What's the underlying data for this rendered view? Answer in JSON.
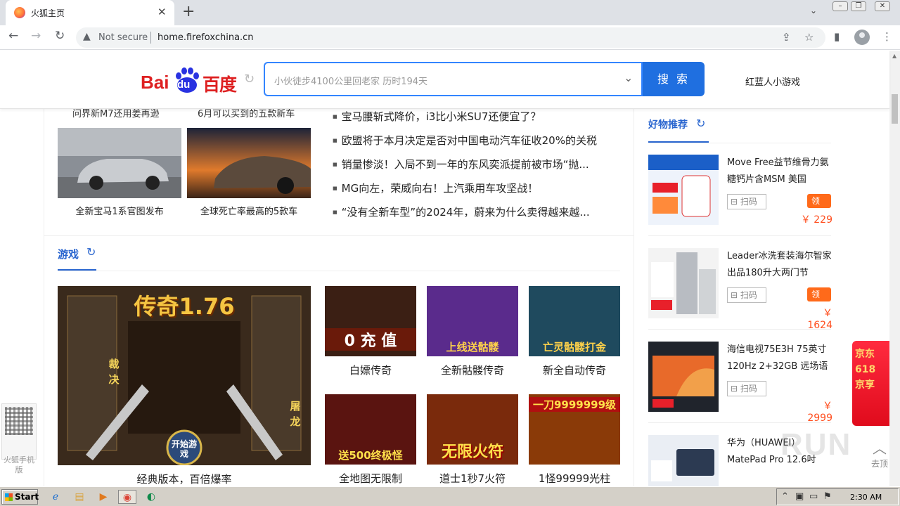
{
  "browser": {
    "tab_title": "火狐主页",
    "address_warning": "Not secure",
    "url": "home.firefoxchina.cn"
  },
  "header": {
    "logo_text_en": "Bai",
    "logo_du": "du",
    "logo_text_cn": "百度",
    "search_placeholder": "小伙徒步4100公里回老家 历时194天",
    "search_button": "搜 索",
    "right_link": "红蓝人小游戏"
  },
  "cars": {
    "cut_captions": [
      "问界新M7还用姜再逊",
      "6月可以买到的五款新车"
    ],
    "items": [
      {
        "caption": "全新宝马1系官图发布"
      },
      {
        "caption": "全球死亡率最高的5款车"
      }
    ],
    "news": [
      "宝马腰斩式降价，i3比小米SU7还便宜了？",
      "欧盟将于本月决定是否对中国电动汽车征收20%的关税",
      "销量惨淡！入局不到一年的东风奕派提前被市场“抛...",
      "MG向左，荣威向右！上汽乘用车攻坚战！",
      "“没有全新车型”的2024年，蔚来为什么卖得越来越..."
    ]
  },
  "games": {
    "section_title": "游戏",
    "featured": {
      "title_art": "传奇1.76",
      "left_art": "裁决",
      "right_art": "屠龙",
      "button_art": "开始游戏",
      "caption": "经典版本，百倍爆率"
    },
    "tiles": [
      {
        "caption": "白嫖传奇",
        "art": "0 充 值",
        "bg": "#3b1f14"
      },
      {
        "caption": "全新骷髅传奇",
        "art": "上线送骷髅",
        "bg": "#5a2b8c"
      },
      {
        "caption": "新全自动传奇",
        "art": "亡灵骷髅打金",
        "bg": "#1f4a5e"
      },
      {
        "caption": "全地图无限制",
        "art": "送500终极怪",
        "bg": "#5a1410"
      },
      {
        "caption": "道士1秒7火符",
        "art": "无限火符",
        "bg": "#7a2a0c"
      },
      {
        "caption": "1怪99999光柱",
        "art": "一刀9999999级",
        "bg": "#8a3a08"
      }
    ]
  },
  "sidebar": {
    "title": "好物推荐",
    "scan_label": "扫码",
    "coupon_label": "领券",
    "products": [
      {
        "name": "Move Free益节维骨力氨糖钙片含MSM 美国",
        "price": "￥ 229",
        "has_coupon": true,
        "bg": "#e8eef8"
      },
      {
        "name": "Leader冰洗套装海尔智家出品180升大两门节",
        "price": "￥ 1624",
        "has_coupon": true,
        "bg": "#f0f0f0"
      },
      {
        "name": "海信电视75E3H 75英寸 120Hz 2+32GB 远场语",
        "price": "￥ 2999",
        "has_coupon": false,
        "bg": "#20242c"
      },
      {
        "name": "华为（HUAWEI）MatePad Pro 12.6吋",
        "price": "",
        "has_coupon": false,
        "bg": "#e8edf4"
      }
    ],
    "jd_ad": "京东618 京享"
  },
  "floating": {
    "qr_text": "火狐手机版",
    "watermark": "RUN",
    "back_top": "去顶"
  },
  "taskbar": {
    "start": "Start",
    "clock": "2:30 AM"
  },
  "colors": {
    "accent_blue": "#2965cf",
    "search_blue": "#1f6fe0",
    "price_orange": "#ff4e1e",
    "baidu_red": "#de2021"
  }
}
